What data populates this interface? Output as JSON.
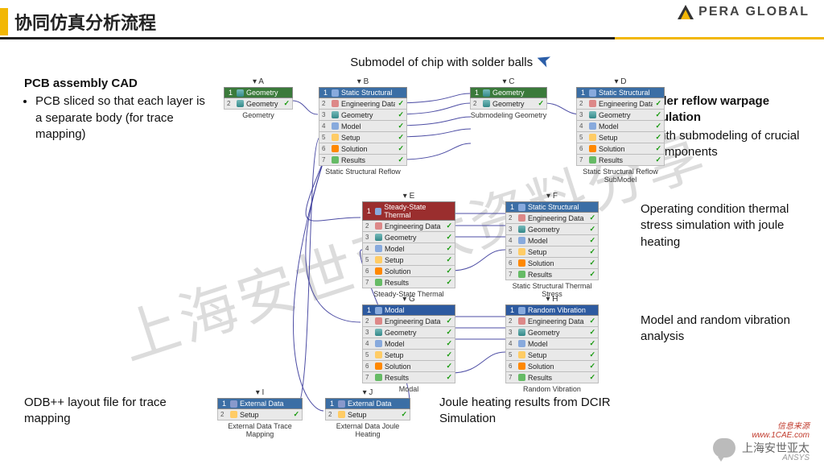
{
  "header": {
    "title": "协同仿真分析流程",
    "brand": "PERA GLOBAL"
  },
  "watermark": "上海安世亚太资料分享",
  "footer": {
    "wechat": "上海安世亚太",
    "brand2": "ANSYS",
    "site": "信息来源\nwww.1CAE.com"
  },
  "annotations": {
    "top": "Submodel of chip with solder balls",
    "left1_title": "PCB assembly CAD",
    "left1_bullet": "PCB sliced so that each layer is a separate body (for trace mapping)",
    "right1_title": "Solder reflow warpage simulation",
    "right1_bullet": "With submodeling of crucial components",
    "right2": "Operating condition thermal stress simulation with joule heating",
    "right3": "Model and random vibration analysis",
    "left2": "ODB++ layout file for trace mapping",
    "bottom": "Joule heating results from DCIR Simulation"
  },
  "blocks": {
    "A": {
      "col": "A",
      "caption": "Geometry",
      "header": "Geometry",
      "rows": [
        {
          "n": "2",
          "label": "Geometry"
        }
      ]
    },
    "B": {
      "col": "B",
      "caption": "Static Structural Reflow",
      "header": "Static Structural",
      "rows": [
        {
          "n": "2",
          "label": "Engineering Data"
        },
        {
          "n": "3",
          "label": "Geometry"
        },
        {
          "n": "4",
          "label": "Model"
        },
        {
          "n": "5",
          "label": "Setup"
        },
        {
          "n": "6",
          "label": "Solution"
        },
        {
          "n": "7",
          "label": "Results"
        }
      ]
    },
    "C": {
      "col": "C",
      "caption": "Submodeling Geometry",
      "header": "Geometry",
      "rows": [
        {
          "n": "2",
          "label": "Geometry"
        }
      ]
    },
    "D": {
      "col": "D",
      "caption": "Static Structural Reflow SubModel",
      "header": "Static Structural",
      "rows": [
        {
          "n": "2",
          "label": "Engineering Data"
        },
        {
          "n": "3",
          "label": "Geometry"
        },
        {
          "n": "4",
          "label": "Model"
        },
        {
          "n": "5",
          "label": "Setup"
        },
        {
          "n": "6",
          "label": "Solution"
        },
        {
          "n": "7",
          "label": "Results"
        }
      ]
    },
    "E": {
      "col": "E",
      "caption": "Steady-State Thermal",
      "header": "Steady-State Thermal",
      "rows": [
        {
          "n": "2",
          "label": "Engineering Data"
        },
        {
          "n": "3",
          "label": "Geometry"
        },
        {
          "n": "4",
          "label": "Model"
        },
        {
          "n": "5",
          "label": "Setup"
        },
        {
          "n": "6",
          "label": "Solution"
        },
        {
          "n": "7",
          "label": "Results"
        }
      ]
    },
    "F": {
      "col": "F",
      "caption": "Static Structural Thermal Stress",
      "header": "Static Structural",
      "rows": [
        {
          "n": "2",
          "label": "Engineering Data"
        },
        {
          "n": "3",
          "label": "Geometry"
        },
        {
          "n": "4",
          "label": "Model"
        },
        {
          "n": "5",
          "label": "Setup"
        },
        {
          "n": "6",
          "label": "Solution"
        },
        {
          "n": "7",
          "label": "Results"
        }
      ]
    },
    "G": {
      "col": "G",
      "caption": "Modal",
      "header": "Modal",
      "rows": [
        {
          "n": "2",
          "label": "Engineering Data"
        },
        {
          "n": "3",
          "label": "Geometry"
        },
        {
          "n": "4",
          "label": "Model"
        },
        {
          "n": "5",
          "label": "Setup"
        },
        {
          "n": "6",
          "label": "Solution"
        },
        {
          "n": "7",
          "label": "Results"
        }
      ]
    },
    "H": {
      "col": "H",
      "caption": "Random Vibration",
      "header": "Random Vibration",
      "rows": [
        {
          "n": "2",
          "label": "Engineering Data"
        },
        {
          "n": "3",
          "label": "Geometry"
        },
        {
          "n": "4",
          "label": "Model"
        },
        {
          "n": "5",
          "label": "Setup"
        },
        {
          "n": "6",
          "label": "Solution"
        },
        {
          "n": "7",
          "label": "Results"
        }
      ]
    },
    "I": {
      "col": "I",
      "caption": "External Data Trace Mapping",
      "header": "External Data",
      "rows": [
        {
          "n": "2",
          "label": "Setup"
        }
      ]
    },
    "J": {
      "col": "J",
      "caption": "External Data Joule Heating",
      "header": "External Data",
      "rows": [
        {
          "n": "2",
          "label": "Setup"
        }
      ]
    }
  }
}
